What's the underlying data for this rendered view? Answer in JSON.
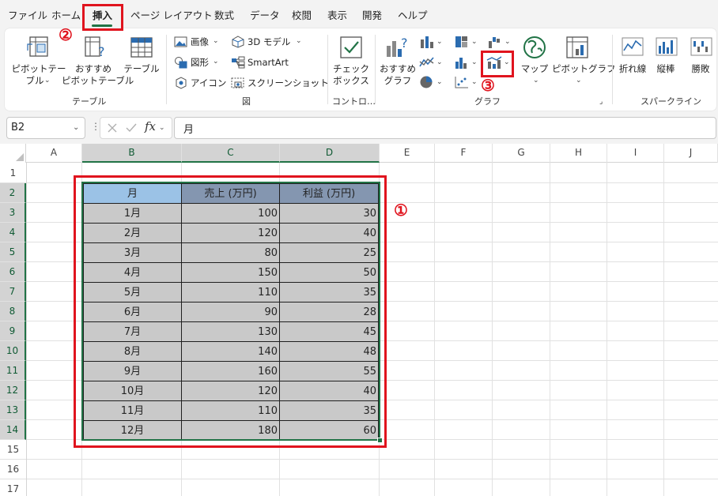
{
  "menu": {
    "tabs": [
      {
        "label": "ファイル"
      },
      {
        "label": "ホーム"
      },
      {
        "label": "挿入"
      },
      {
        "label": "ページ レイアウト"
      },
      {
        "label": "数式"
      },
      {
        "label": "データ"
      },
      {
        "label": "校閲"
      },
      {
        "label": "表示"
      },
      {
        "label": "開発"
      },
      {
        "label": "ヘルプ"
      }
    ],
    "active": "挿入"
  },
  "ribbon": {
    "table_group": {
      "label": "テーブル",
      "pivot_table_line1": "ピボットテー",
      "pivot_table_line2": "ブル",
      "recommended_pivot_line1": "おすすめ",
      "recommended_pivot_line2": "ピボットテーブル",
      "table": "テーブル"
    },
    "illustrations_group": {
      "label": "図",
      "image": "画像",
      "shapes": "図形",
      "icons": "アイコン",
      "model_3d": "3D モデル",
      "smartart": "SmartArt",
      "screenshot": "スクリーンショット"
    },
    "controls_group": {
      "label": "コントロ…",
      "checkbox_line1": "チェック",
      "checkbox_line2": "ボックス"
    },
    "charts_group": {
      "label": "グラフ",
      "recommended_line1": "おすすめ",
      "recommended_line2": "グラフ",
      "map": "マップ",
      "pivot_chart": "ピボットグラフ"
    },
    "sparklines_group": {
      "label": "スパークライン",
      "line": "折れ線",
      "column": "縦棒",
      "win_loss": "勝敗"
    }
  },
  "formula_bar": {
    "name_box": "B2",
    "fx": "fx",
    "content": "月"
  },
  "grid": {
    "columns": [
      "A",
      "B",
      "C",
      "D",
      "E",
      "F",
      "G",
      "H",
      "I",
      "J"
    ],
    "rows": [
      "1",
      "2",
      "3",
      "4",
      "5",
      "6",
      "7",
      "8",
      "9",
      "10",
      "11",
      "12",
      "13",
      "14",
      "15",
      "16",
      "17"
    ],
    "selected_columns": [
      "B",
      "C",
      "D"
    ],
    "selected_rows_from": 2,
    "selected_rows_to": 14
  },
  "table": {
    "headers": [
      "月",
      "売上 (万円)",
      "利益 (万円)"
    ],
    "rows": [
      [
        "1月",
        "100",
        "30"
      ],
      [
        "2月",
        "120",
        "40"
      ],
      [
        "3月",
        "80",
        "25"
      ],
      [
        "4月",
        "150",
        "50"
      ],
      [
        "5月",
        "110",
        "35"
      ],
      [
        "6月",
        "90",
        "28"
      ],
      [
        "7月",
        "130",
        "45"
      ],
      [
        "8月",
        "140",
        "48"
      ],
      [
        "9月",
        "160",
        "55"
      ],
      [
        "10月",
        "120",
        "40"
      ],
      [
        "11月",
        "110",
        "35"
      ],
      [
        "12月",
        "180",
        "60"
      ]
    ]
  },
  "annotations": {
    "step1": "①",
    "step2": "②",
    "step3": "③",
    "color": "#e0141e"
  },
  "colors": {
    "accent": "#217346",
    "header_first": "#9bc2e6",
    "header": "#8496b0",
    "body": "#c9c9c9"
  }
}
